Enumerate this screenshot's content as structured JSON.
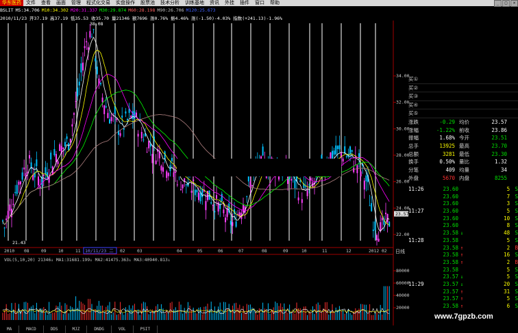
{
  "menu": {
    "app_label": "华东医药",
    "items": [
      "文件",
      "查看",
      "画面",
      "管理",
      "程式化交易",
      "实盘操作",
      "股票池",
      "技术分析",
      "训练基地",
      "资讯",
      "外挂",
      "插件",
      "窗口",
      "帮助"
    ]
  },
  "stock": {
    "name": "华东医药",
    "ma_legend": [
      "BSLIT",
      "M5:34.706",
      "M10:34.302",
      "M20:31.337",
      "M30:29.874",
      "M60:28.198",
      "M90:26.706",
      "M120:25.673"
    ],
    "ohlc_line": "2010/11/23 开37.19 高37.19 低35.53 收35.70 量21346 额7696 涨0.76% 振4.46% 涨(-1.50)-4.03% 指数(+241.13)-1.96%",
    "peak_label": "38.08",
    "low_label": "21.43",
    "current_price_tag": "23.57"
  },
  "price_axis": {
    "ticks": [
      "34.00",
      "32.00",
      "30.00",
      "28.00",
      "26.00",
      "24.00",
      "22.00"
    ],
    "unit": "日线"
  },
  "date_axis": {
    "ticks": [
      "2010",
      "08",
      "09",
      "10",
      "11",
      "2011",
      "02",
      "03",
      "04",
      "05",
      "06",
      "07",
      "08",
      "09",
      "10",
      "11",
      "12",
      "2012",
      "02"
    ],
    "selected_date": "10/11/23 二"
  },
  "volume": {
    "legend": "VOL(5,10,20) 21346↓ MA1:31681.199↓ MA2:41475.363↓ MA3:40940.813↓",
    "axis_ticks": [
      "80000",
      "60000",
      "40000",
      "20000"
    ]
  },
  "quote": {
    "buy_labels": [
      "买①",
      "买②",
      "买③",
      "买④",
      "买⑤"
    ],
    "rows": [
      {
        "k": "涨跌",
        "v": "-0.29",
        "k2": "均价",
        "v2": "23.57",
        "vc": "#00e000",
        "v2c": "#ffffff"
      },
      {
        "k": "涨幅",
        "v": "-1.22%",
        "k2": "前收",
        "v2": "23.86",
        "vc": "#00e000",
        "v2c": "#ffffff"
      },
      {
        "k": "振幅",
        "v": "1.68%",
        "k2": "今开",
        "v2": "23.51",
        "vc": "#ffffff",
        "v2c": "#00e000"
      },
      {
        "k": "总手",
        "v": "13925",
        "k2": "最高",
        "v2": "23.70",
        "vc": "#ffff00",
        "v2c": "#00e000"
      },
      {
        "k": "总额",
        "v": "3281",
        "k2": "最低",
        "v2": "23.30",
        "vc": "#ffff00",
        "v2c": "#00e000"
      },
      {
        "k": "换手",
        "v": "0.50%",
        "k2": "量比",
        "v2": "1.32",
        "vc": "#ffffff",
        "v2c": "#ffffff"
      },
      {
        "k": "分笔",
        "v": "409",
        "k2": "均量",
        "v2": "34",
        "vc": "#ffffff",
        "v2c": "#ffffff"
      },
      {
        "k": "外盘",
        "v": "5670",
        "k2": "内盘",
        "v2": "8255",
        "vc": "#ff3030",
        "v2c": "#00e000"
      }
    ]
  },
  "ticks": [
    {
      "t": "11:26",
      "p": "23.60",
      "a": "",
      "v": "5",
      "bs": "S"
    },
    {
      "t": "",
      "p": "23.60",
      "a": "",
      "v": "7",
      "bs": "S"
    },
    {
      "t": "",
      "p": "23.60",
      "a": "",
      "v": "3",
      "bs": "S"
    },
    {
      "t": "11:27",
      "p": "23.60",
      "a": "",
      "v": "5",
      "bs": "S"
    },
    {
      "t": "",
      "p": "23.60",
      "a": "",
      "v": "10",
      "bs": "S"
    },
    {
      "t": "",
      "p": "23.60",
      "a": "",
      "v": "8",
      "bs": "S"
    },
    {
      "t": "",
      "p": "23.58",
      "a": "↓",
      "v": "48",
      "bs": "S"
    },
    {
      "t": "11:28",
      "p": "23.58",
      "a": "",
      "v": "5",
      "bs": "S"
    },
    {
      "t": "",
      "p": "23.58",
      "a": "↑",
      "v": "2",
      "bs": "B"
    },
    {
      "t": "",
      "p": "23.58",
      "a": "↑",
      "v": "16",
      "bs": "S"
    },
    {
      "t": "",
      "p": "23.58",
      "a": "↑",
      "v": "2",
      "bs": "B"
    },
    {
      "t": "",
      "p": "23.58",
      "a": "",
      "v": "5",
      "bs": "S"
    },
    {
      "t": "",
      "p": "23.57",
      "a": "↓",
      "v": "5",
      "bs": "S"
    },
    {
      "t": "11:29",
      "p": "23.57",
      "a": "↓",
      "v": "20",
      "bs": "S"
    },
    {
      "t": "",
      "p": "23.57",
      "a": "↑",
      "v": "31",
      "bs": "S"
    },
    {
      "t": "",
      "p": "23.57",
      "a": "↑",
      "v": "5",
      "bs": "S"
    },
    {
      "t": "",
      "p": "23.58",
      "a": "↑",
      "v": "6",
      "bs": "S"
    }
  ],
  "toolbar": {
    "items": [
      "MA",
      "MACD",
      "DDS",
      "MJZ",
      "DNDG",
      "VOL",
      "PSIT"
    ]
  },
  "watermark": "www.7gpzb.com",
  "colors": {
    "up": "#ff40ff",
    "down": "#00c0ff",
    "ma5": "#ffffff",
    "ma10": "#ffff00",
    "ma20": "#ff00ff",
    "ma30": "#00ff00",
    "ma60": "#b08080",
    "axis": "#a00000"
  }
}
